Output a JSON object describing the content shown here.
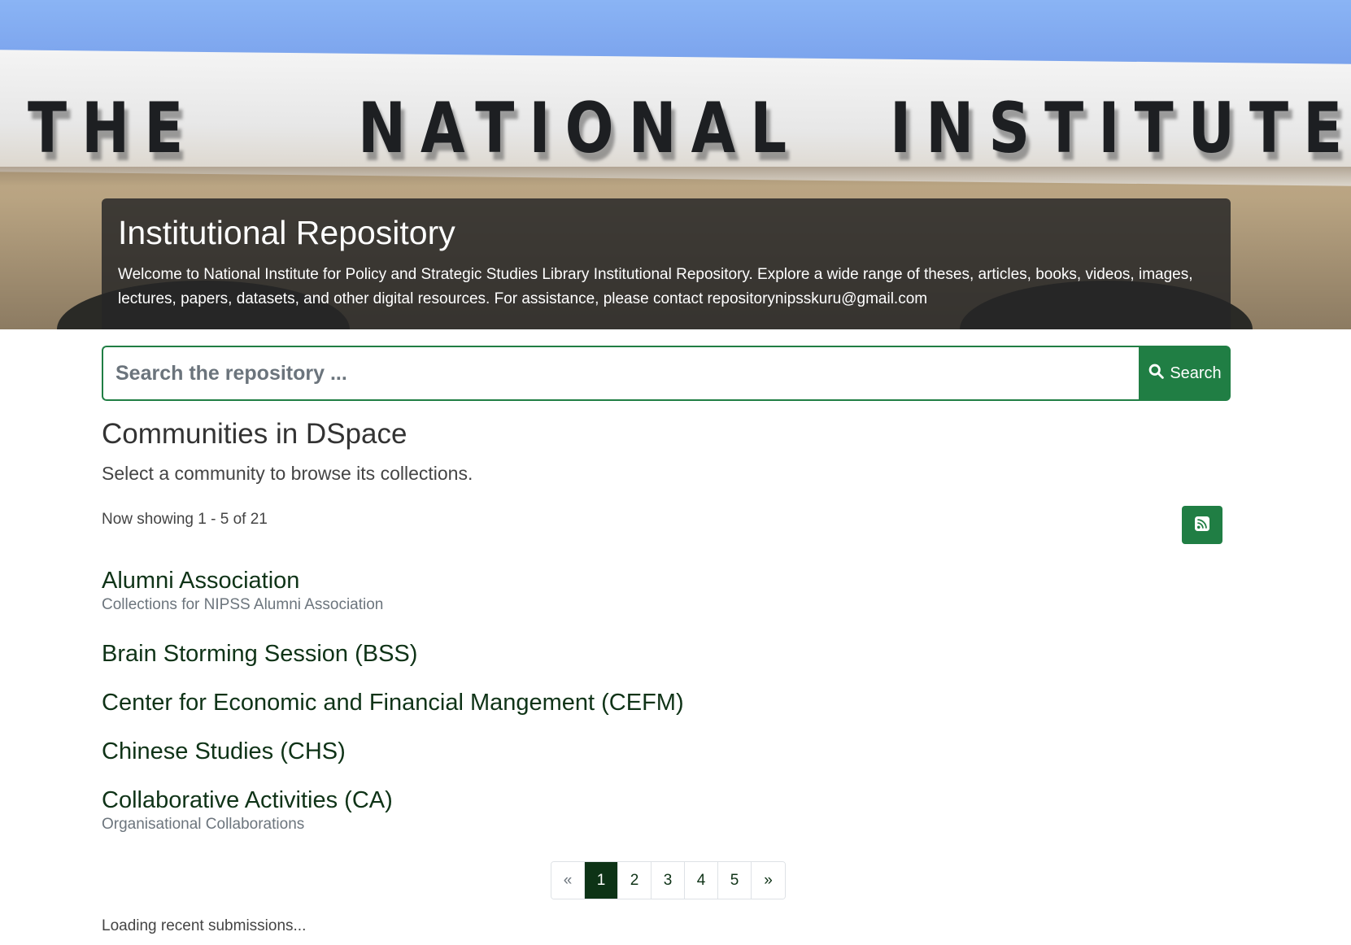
{
  "banner": {
    "sign_words": [
      "THE",
      "NATIONAL",
      "INSTITUTE"
    ],
    "title": "Institutional Repository",
    "welcome_text": "Welcome to National Institute for Policy and Strategic Studies Library Institutional Repository. Explore a wide range of theses, articles, books, videos, images, lectures, papers, datasets, and other digital resources. For assistance, please contact repositorynipsskuru@gmail.com"
  },
  "search": {
    "placeholder": "Search the repository ...",
    "button_label": "Search",
    "icon": "search-icon"
  },
  "communities": {
    "heading": "Communities in DSpace",
    "subheading": "Select a community to browse its collections.",
    "showing": "Now showing 1 - 5 of 21",
    "rss_icon": "rss-icon",
    "items": [
      {
        "name": "Alumni Association",
        "description": "Collections for NIPSS Alumni Association"
      },
      {
        "name": "Brain Storming Session (BSS)",
        "description": ""
      },
      {
        "name": "Center for Economic and Financial Mangement (CEFM)",
        "description": ""
      },
      {
        "name": "Chinese Studies (CHS)",
        "description": ""
      },
      {
        "name": "Collaborative Activities (CA)",
        "description": "Organisational Collaborations"
      }
    ]
  },
  "pagination": {
    "prev": "«",
    "pages": [
      "1",
      "2",
      "3",
      "4",
      "5"
    ],
    "active_page": "1",
    "next": "»"
  },
  "recent": {
    "loading_text": "Loading recent submissions..."
  },
  "colors": {
    "primary": "#207e44",
    "link": "#0f3317",
    "active_page": "#0d3316"
  }
}
